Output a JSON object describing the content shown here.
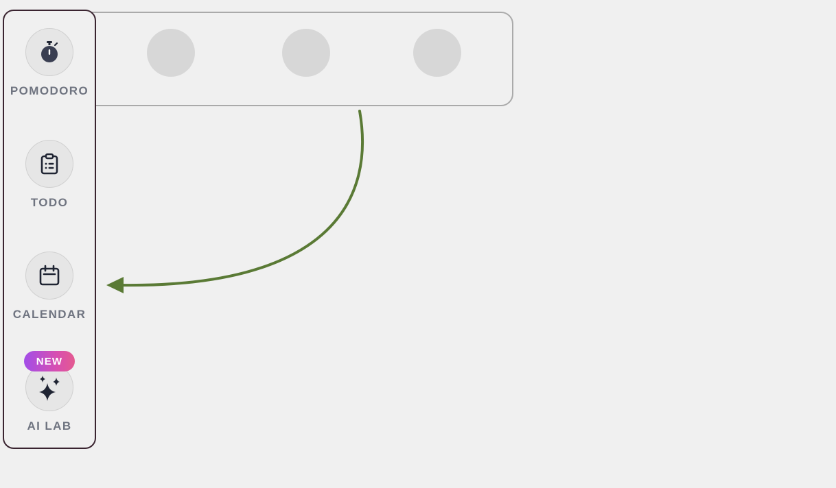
{
  "colors": {
    "background": "#f0f0f0",
    "vertical_dock_border": "#3a2430",
    "horizontal_dock_border": "#aaaaaa",
    "label": "#6f7480",
    "icon": "#1f2433",
    "arrow": "#5a7a35",
    "badge_gradient_start": "#a24ee8",
    "badge_gradient_end": "#e45a90"
  },
  "horizontal_dock": {
    "placeholder_icons": [
      "placeholder-circle",
      "placeholder-circle",
      "placeholder-circle"
    ]
  },
  "vertical_dock": {
    "items": [
      {
        "label": "POMODORO",
        "icon": "stopwatch-icon"
      },
      {
        "label": "TODO",
        "icon": "clipboard-list-icon"
      },
      {
        "label": "CALENDAR",
        "icon": "calendar-icon"
      },
      {
        "label": "AI LAB",
        "icon": "sparkles-icon",
        "badge": "NEW"
      }
    ]
  },
  "annotation": {
    "arrow": "curved-arrow-pointing-left"
  }
}
